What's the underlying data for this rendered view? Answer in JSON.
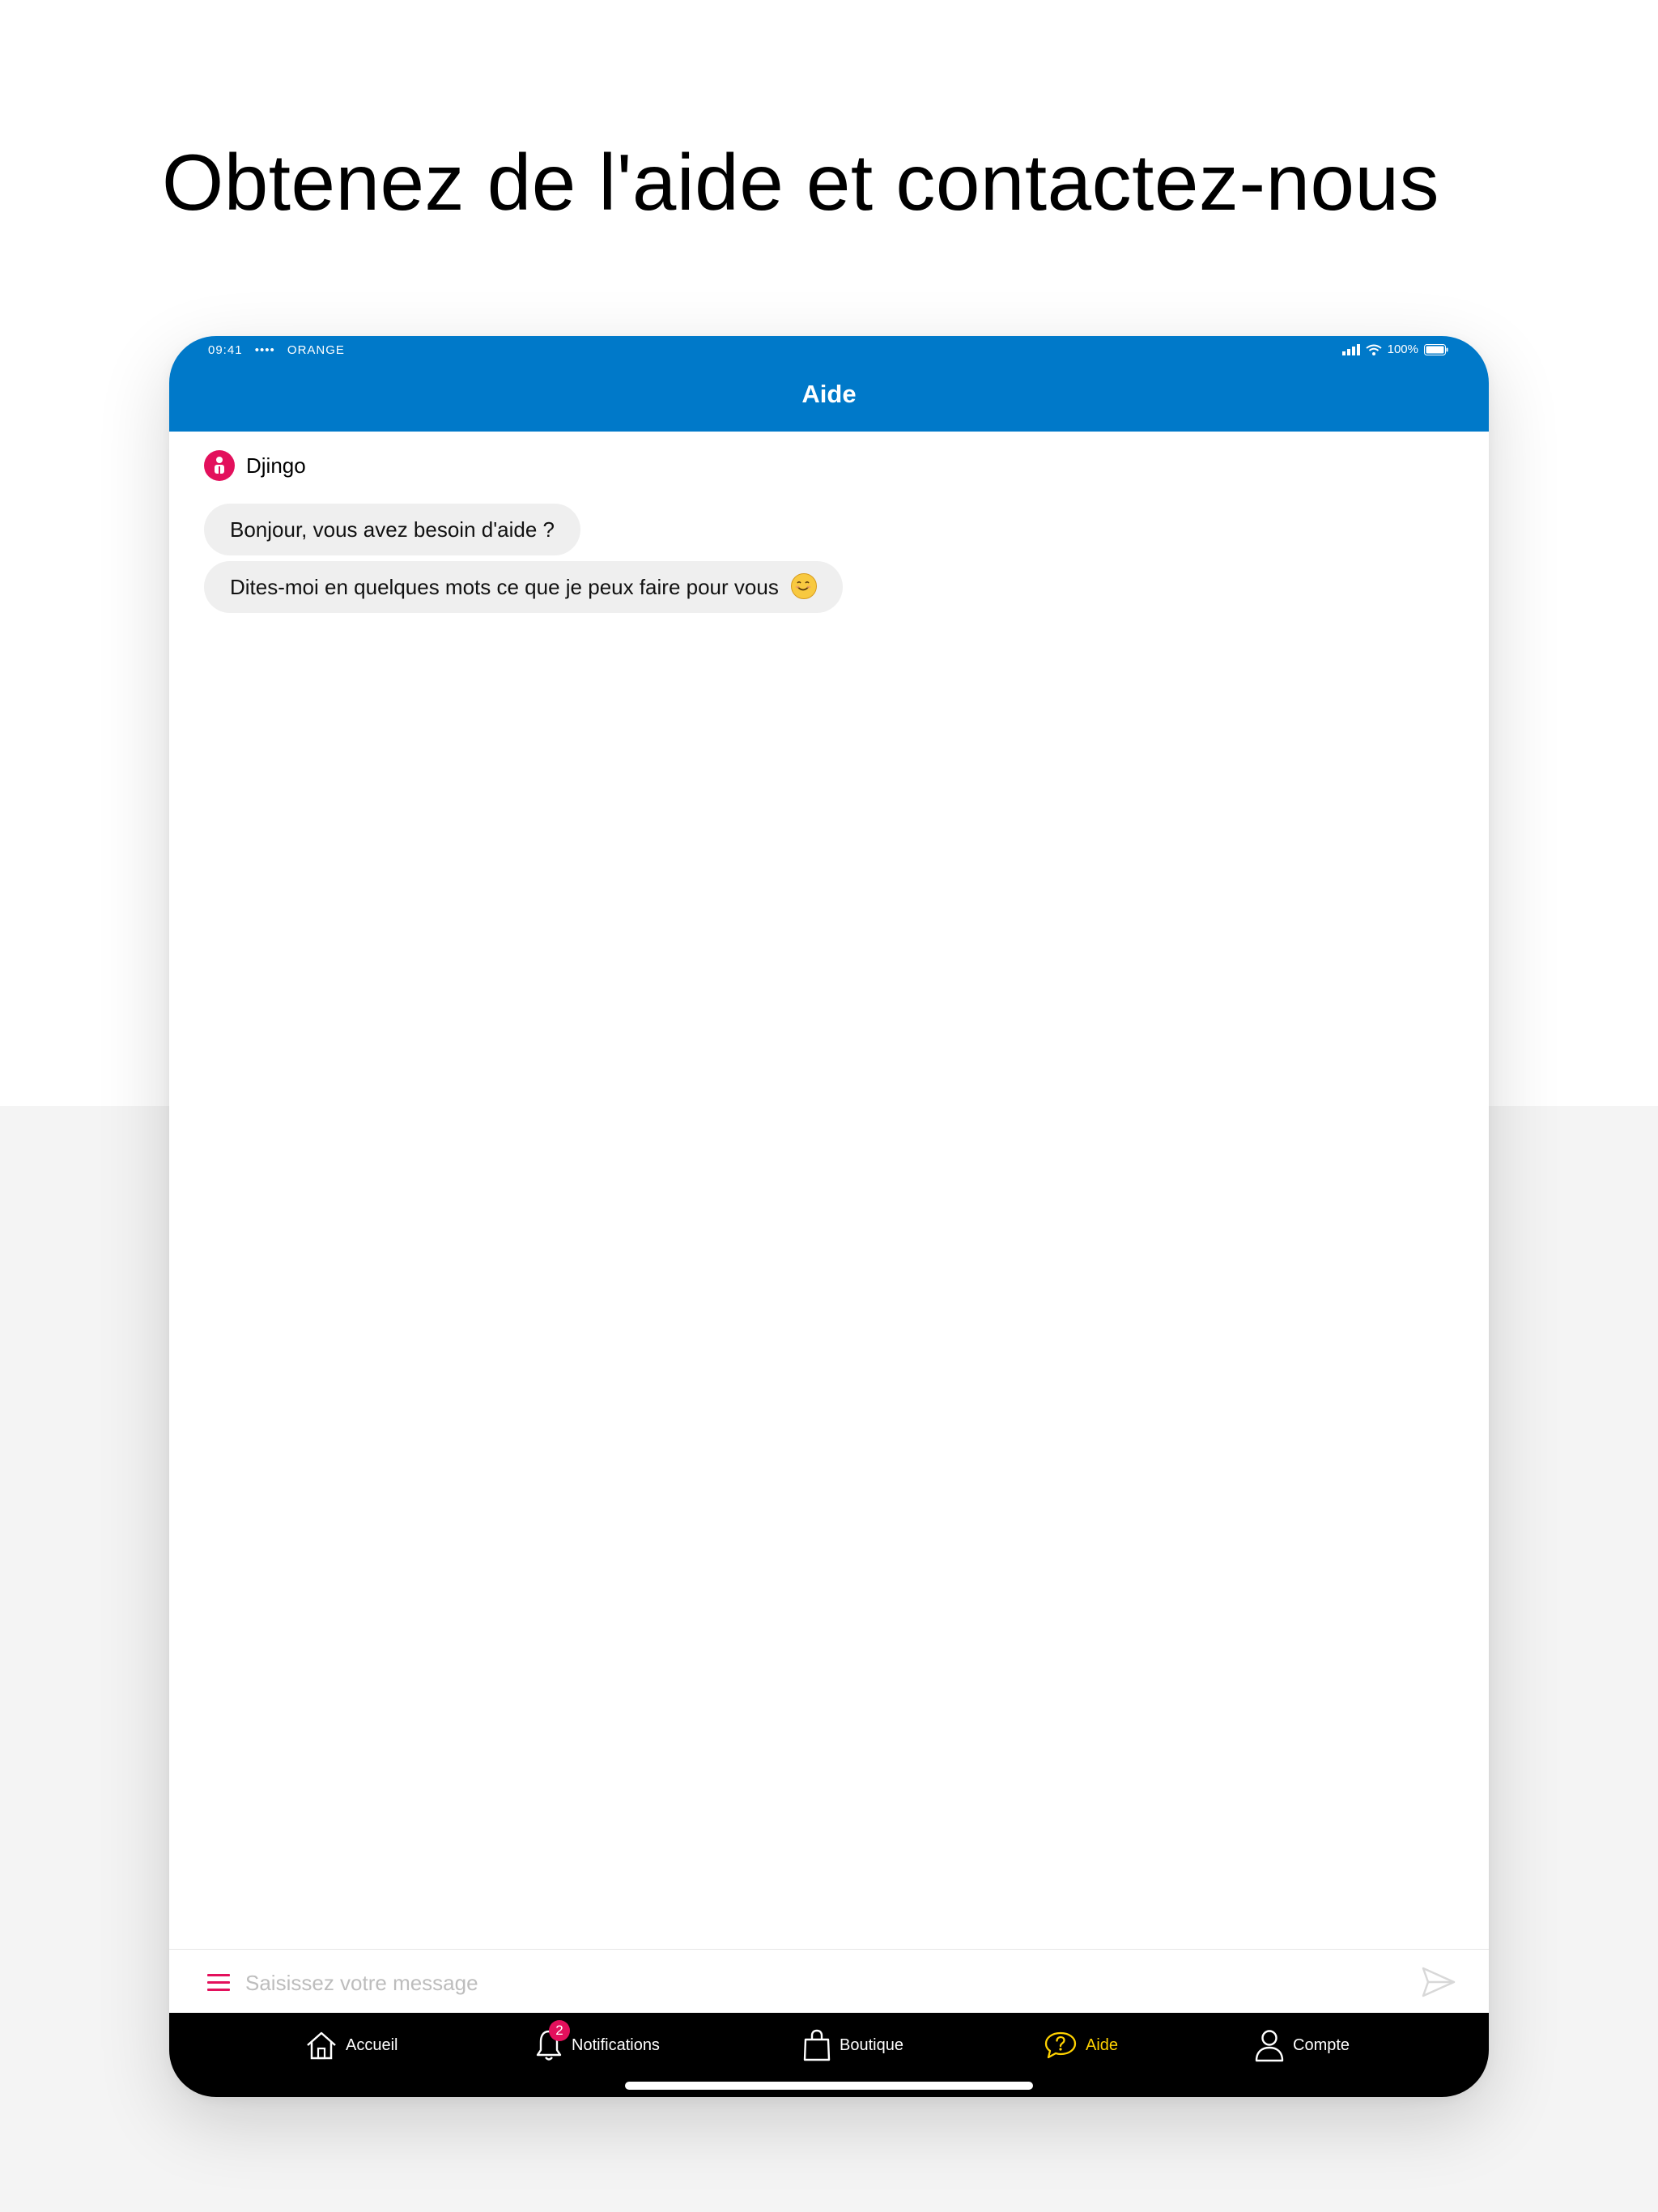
{
  "headline": "Obtenez de l'aide et contactez-nous",
  "status_bar": {
    "time": "09:41",
    "signal_dots": "••••",
    "carrier": "ORANGE",
    "battery": "100%"
  },
  "header": {
    "title": "Aide"
  },
  "chat": {
    "sender": "Djingo",
    "messages": [
      {
        "text": "Bonjour, vous avez besoin d'aide ?"
      },
      {
        "text": "Dites-moi en quelques mots ce que je peux faire pour vous"
      }
    ]
  },
  "composer": {
    "placeholder": "Saisissez votre message",
    "value": ""
  },
  "tabs": [
    {
      "label": "Accueil",
      "icon": "home-icon"
    },
    {
      "label": "Notifications",
      "icon": "bell-icon",
      "badge": "2"
    },
    {
      "label": "Boutique",
      "icon": "shopping-bag-icon"
    },
    {
      "label": "Aide",
      "icon": "help-bubble-icon",
      "active": true
    },
    {
      "label": "Compte",
      "icon": "user-icon"
    }
  ],
  "colors": {
    "brand_blue": "#0079c9",
    "accent_pink": "#e3105c",
    "active_tab_yellow": "#ffd200",
    "tabbar_black": "#000000",
    "bubble_grey": "#efefef"
  }
}
